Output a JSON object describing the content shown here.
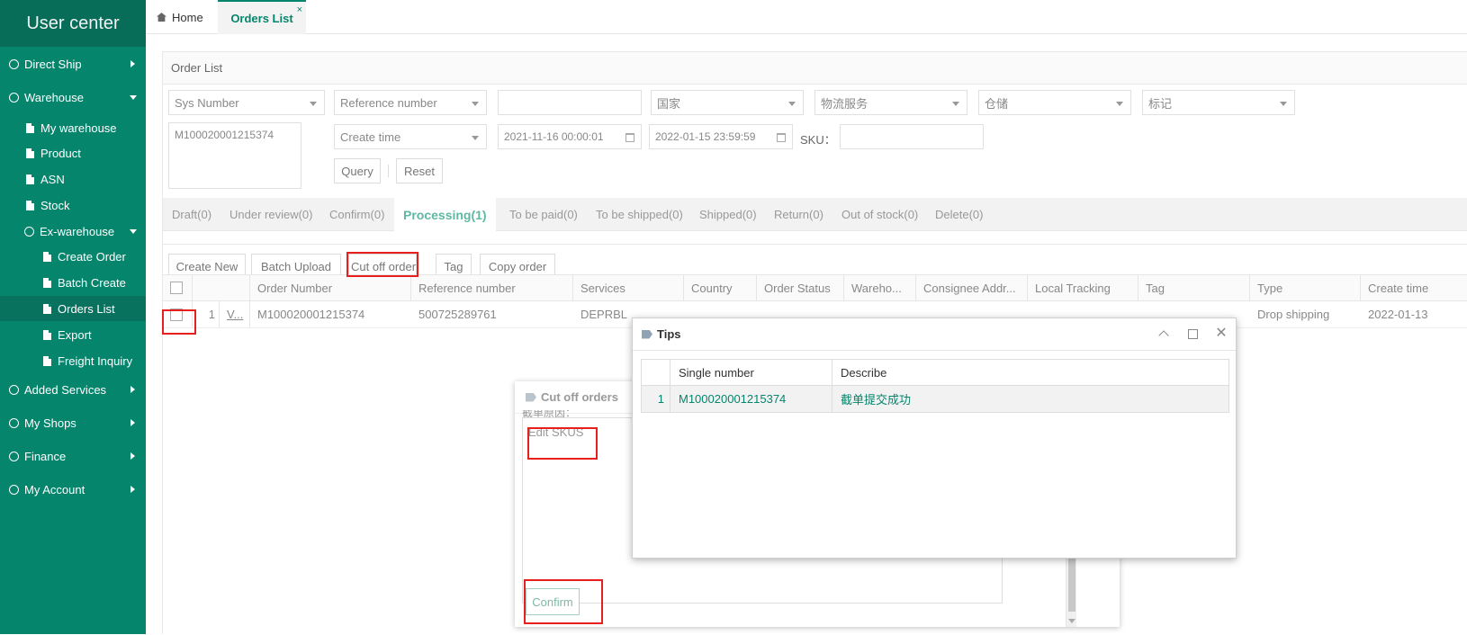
{
  "sidebar": {
    "brand": "User center",
    "items": [
      {
        "label": "Direct Ship"
      },
      {
        "label": "Warehouse"
      },
      {
        "label": "My warehouse"
      },
      {
        "label": "Product"
      },
      {
        "label": "ASN"
      },
      {
        "label": "Stock"
      },
      {
        "label": "Ex-warehouse"
      },
      {
        "label": "Create Order"
      },
      {
        "label": "Batch Create"
      },
      {
        "label": "Orders List"
      },
      {
        "label": "Export"
      },
      {
        "label": "Freight Inquiry"
      },
      {
        "label": "Added Services"
      },
      {
        "label": "My Shops"
      },
      {
        "label": "Finance"
      },
      {
        "label": "My Account"
      }
    ]
  },
  "tabs": {
    "home": "Home",
    "orders": "Orders List",
    "close": "×"
  },
  "panel": {
    "title": "Order List"
  },
  "filters": {
    "sys_number": "Sys Number",
    "reference": "Reference number",
    "country": "国家",
    "logistics": "物流服务",
    "warehouse": "仓储",
    "mark": "标记",
    "sys_value": "M100020001215374",
    "time_type": "Create time",
    "date_from": "2021-11-16 00:00:01",
    "date_to": "2022-01-15 23:59:59",
    "sku_label": "SKU：",
    "query": "Query",
    "reset": "Reset"
  },
  "status_tabs": [
    "Draft(0)",
    "Under review(0)",
    "Confirm(0)",
    "Processing(1)",
    "To be paid(0)",
    "To be shipped(0)",
    "Shipped(0)",
    "Return(0)",
    "Out of stock(0)",
    "Delete(0)"
  ],
  "actions": {
    "create": "Create New",
    "batch": "Batch Upload",
    "cut": "Cut off orders",
    "tag": "Tag",
    "copy": "Copy order"
  },
  "table": {
    "headers": [
      "Order Number",
      "Reference number",
      "Services",
      "Country",
      "Order Status",
      "Wareho...",
      "Consignee Addr...",
      "Local Tracking",
      "Tag",
      "Type",
      "Create time"
    ],
    "row": {
      "index": "1",
      "link": "V...",
      "order": "M100020001215374",
      "reference": "500725289761",
      "service": "DEPRBL",
      "type": "Drop shipping",
      "created": "2022-01-13"
    }
  },
  "cut_dialog": {
    "title": "Cut off orders",
    "partial": "截单原因：",
    "edit": "Edit SKUS",
    "confirm": "Confirm"
  },
  "tips_dialog": {
    "title": "Tips",
    "headers": [
      "Single number",
      "Describe"
    ],
    "row": {
      "index": "1",
      "number": "M100020001215374",
      "desc": "截单提交成功"
    }
  },
  "colors": {
    "brand": "#05856c",
    "highlight": "#e8201d"
  }
}
